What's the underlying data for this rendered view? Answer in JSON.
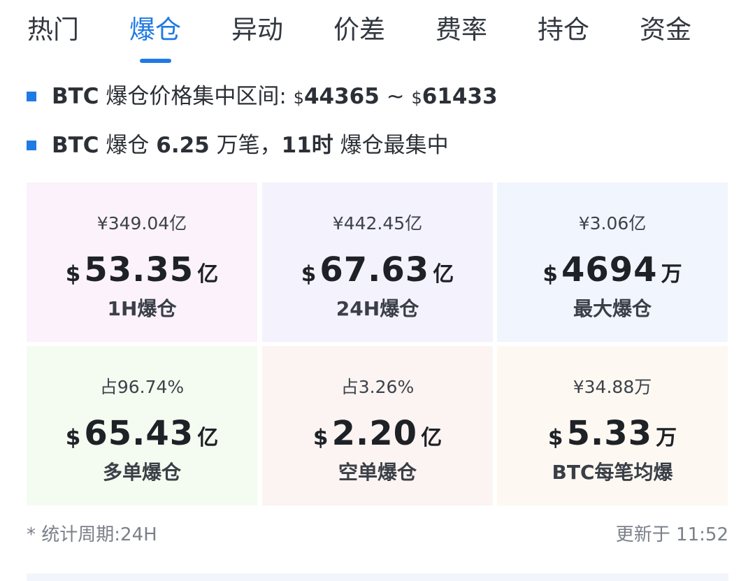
{
  "tabs": [
    {
      "label": "热门"
    },
    {
      "label": "爆仓"
    },
    {
      "label": "异动"
    },
    {
      "label": "价差"
    },
    {
      "label": "费率"
    },
    {
      "label": "持仓"
    },
    {
      "label": "资金"
    }
  ],
  "active_tab": "爆仓",
  "summary": {
    "line1": {
      "coin": "BTC",
      "text": " 爆仓价格集中区间: ",
      "cur1": "$",
      "low": "44365",
      "sep": " ~ ",
      "cur2": "$",
      "high": "61433"
    },
    "line2": {
      "coin": "BTC",
      "text1": " 爆仓 ",
      "count": "6.25",
      "text2": " 万笔，",
      "hour": "11时",
      "text3": " 爆仓最集中"
    }
  },
  "stats": [
    {
      "top": "¥349.04亿",
      "cur": "$",
      "value": "53.35",
      "unit": "亿",
      "label": "1H爆仓",
      "bg": "#fbf2fc"
    },
    {
      "top": "¥442.45亿",
      "cur": "$",
      "value": "67.63",
      "unit": "亿",
      "label": "24H爆仓",
      "bg": "#f4f2fc"
    },
    {
      "top": "¥3.06亿",
      "cur": "$",
      "value": "4694",
      "unit": "万",
      "label": "最大爆仓",
      "bg": "#f1f5fd"
    },
    {
      "top": "占96.74%",
      "cur": "$",
      "value": "65.43",
      "unit": "亿",
      "label": "多单爆仓",
      "bg": "#f4fcf1"
    },
    {
      "top": "占3.26%",
      "cur": "$",
      "value": "2.20",
      "unit": "亿",
      "label": "空单爆仓",
      "bg": "#fcf4f2"
    },
    {
      "top": "¥34.88万",
      "cur": "$",
      "value": "5.33",
      "unit": "万",
      "label": "BTC每笔均爆",
      "bg": "#fdf9f2"
    }
  ],
  "footer": {
    "period": "* 统计周期:24H",
    "updated": "更新于 11:52"
  },
  "colors": {
    "accent": "#1f7ae5"
  }
}
